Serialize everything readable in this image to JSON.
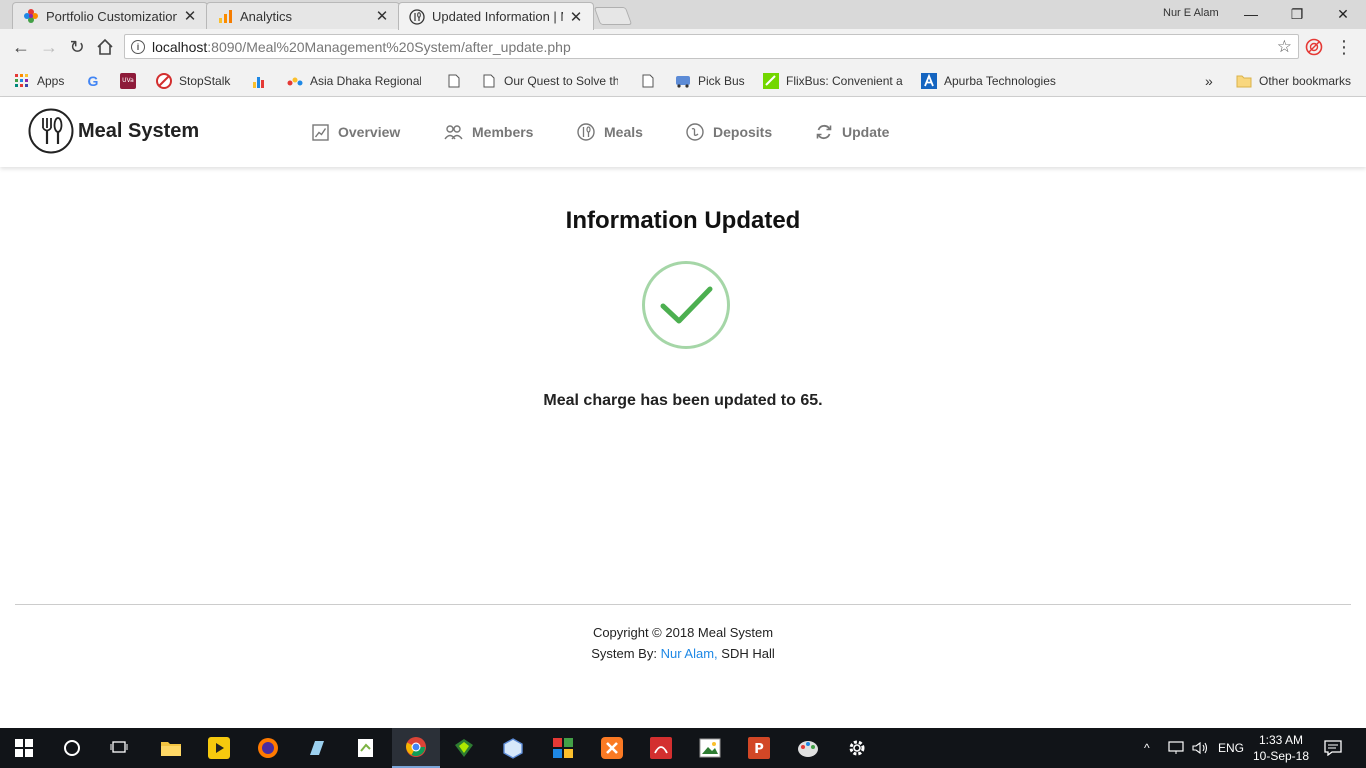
{
  "browser": {
    "tabs": [
      {
        "title": "Portfolio Customization ·",
        "active": false
      },
      {
        "title": "Analytics",
        "active": false
      },
      {
        "title": "Updated Information | M·",
        "active": true
      }
    ],
    "user": "Nur E Alam",
    "url": {
      "host": "localhost",
      "path": ":8090/Meal%20Management%20System/after_update.php"
    },
    "bookmarks": [
      {
        "label": "Apps",
        "icon": "apps-grid-icon"
      },
      {
        "label": "",
        "icon": "google-icon"
      },
      {
        "label": "",
        "icon": "uva-icon"
      },
      {
        "label": "StopStalk",
        "icon": "stopstalk-icon"
      },
      {
        "label": "",
        "icon": "analytics-icon"
      },
      {
        "label": "Asia Dhaka Regional",
        "icon": "acm-icon"
      },
      {
        "label": "",
        "icon": "page-icon"
      },
      {
        "label": "Our Quest to Solve th",
        "icon": "page-icon"
      },
      {
        "label": "",
        "icon": "page-icon"
      },
      {
        "label": "Pick Bus",
        "icon": "bus-icon"
      },
      {
        "label": "FlixBus: Convenient a",
        "icon": "flixbus-icon"
      },
      {
        "label": "Apurba Technologies",
        "icon": "apurba-icon"
      }
    ],
    "bookmarks_overflow": "»",
    "other_bookmarks": "Other bookmarks"
  },
  "app": {
    "brand": "Meal System",
    "nav": [
      {
        "label": "Overview",
        "icon": "chart-icon"
      },
      {
        "label": "Members",
        "icon": "members-icon"
      },
      {
        "label": "Meals",
        "icon": "meal-icon"
      },
      {
        "label": "Deposits",
        "icon": "deposit-icon"
      },
      {
        "label": "Update",
        "icon": "refresh-icon"
      }
    ]
  },
  "main": {
    "title": "Information Updated",
    "message": "Meal charge has been updated to 65."
  },
  "footer": {
    "copyright": "Copyright © 2018 Meal System",
    "system_by": "System By:",
    "author": "Nur Alam,",
    "hall": "SDH Hall"
  },
  "taskbar": {
    "lang": "ENG",
    "time": "1:33 AM",
    "date": "10-Sep-18"
  },
  "colors": {
    "accent_link": "#1e88e5",
    "success_green": "#4caf50",
    "success_ring": "#a5d6a7"
  }
}
